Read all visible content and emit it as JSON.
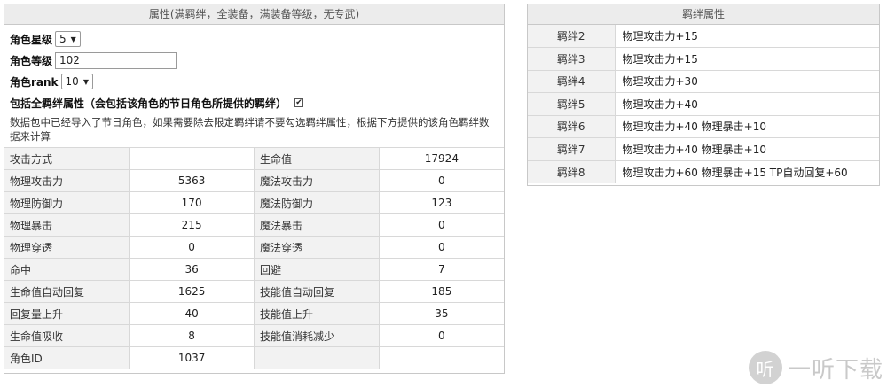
{
  "attributes": {
    "header": "属性(满羁绊，全装备，满装备等级，无专武)",
    "star_label": "角色星级",
    "star_value": "5",
    "level_label": "角色等级",
    "level_value": "102",
    "rank_label": "角色rank",
    "rank_value": "10",
    "bond_check_label": "包括全羁绊属性（会包括该角色的节日角色所提供的羁绊）",
    "bond_checked": "✔",
    "note": "数据包中已经导入了节日角色，如果需要除去限定羁绊请不要勾选羁绊属性，根据下方提供的该角色羁绊数据来计算",
    "rows": [
      [
        "攻击方式",
        "",
        "生命值",
        "17924"
      ],
      [
        "物理攻击力",
        "5363",
        "魔法攻击力",
        "0"
      ],
      [
        "物理防御力",
        "170",
        "魔法防御力",
        "123"
      ],
      [
        "物理暴击",
        "215",
        "魔法暴击",
        "0"
      ],
      [
        "物理穿透",
        "0",
        "魔法穿透",
        "0"
      ],
      [
        "命中",
        "36",
        "回避",
        "7"
      ],
      [
        "生命值自动回复",
        "1625",
        "技能值自动回复",
        "185"
      ],
      [
        "回复量上升",
        "40",
        "技能值上升",
        "35"
      ],
      [
        "生命值吸收",
        "8",
        "技能值消耗减少",
        "0"
      ],
      [
        "角色ID",
        "1037",
        "",
        ""
      ]
    ]
  },
  "bond": {
    "header": "羁绊属性",
    "rows": [
      [
        "羁绊2",
        "物理攻击力+15"
      ],
      [
        "羁绊3",
        "物理攻击力+15"
      ],
      [
        "羁绊4",
        "物理攻击力+30"
      ],
      [
        "羁绊5",
        "物理攻击力+40"
      ],
      [
        "羁绊6",
        "物理攻击力+40 物理暴击+10"
      ],
      [
        "羁绊7",
        "物理攻击力+40 物理暴击+10"
      ],
      [
        "羁绊8",
        "物理攻击力+60 物理暴击+15 TP自动回复+60"
      ]
    ]
  },
  "watermark": {
    "logo_glyph": "听",
    "text": "一听下载"
  },
  "icons": {
    "caret": "chevron-down-icon",
    "check": "checkmark-icon"
  }
}
